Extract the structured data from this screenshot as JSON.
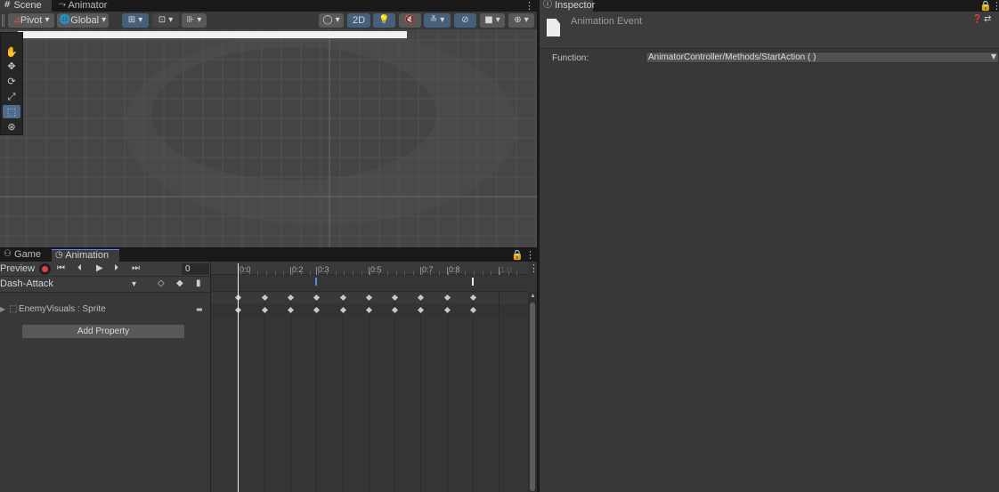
{
  "scene_tabs": [
    {
      "label": "Scene",
      "icon": "grid-icon"
    },
    {
      "label": "Animator",
      "icon": "animator-icon"
    }
  ],
  "scene_toolbar": {
    "pivot": "Pivot",
    "global": "Global",
    "two_d": "2D"
  },
  "bottom_tabs": [
    {
      "label": "Game",
      "icon": "gamepad-icon"
    },
    {
      "label": "Animation",
      "icon": "clock-icon"
    }
  ],
  "animation": {
    "preview_label": "Preview",
    "frame_value": "0",
    "clip_name": "Dash-Attack",
    "property_label": "EnemyVisuals : Sprite",
    "add_property_label": "Add Property",
    "ticks": [
      "0:0",
      "0:2",
      "0:3",
      "0:5",
      "0:7",
      "0:8",
      "1:0"
    ]
  },
  "inspector": {
    "tab_label": "Inspector",
    "title": "Animation Event",
    "function_label": "Function:",
    "function_value": "AnimatorController/Methods/StartAction ( )"
  },
  "colors": {
    "accent_blue": "#46607c",
    "record_red": "#e04040",
    "event_marker": "#4a8cf0"
  }
}
